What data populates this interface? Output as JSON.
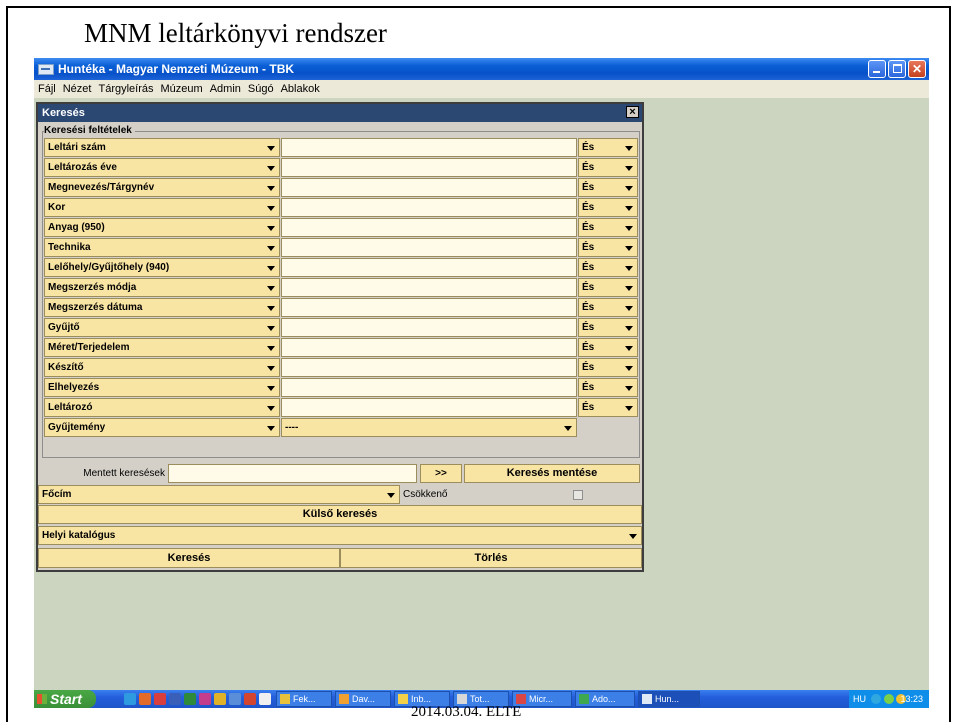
{
  "slide": {
    "title": "MNM leltárkönyvi rendszer",
    "footer": "2014.03.04. ELTE"
  },
  "window": {
    "title": "Huntéka - Magyar Nemzeti Múzeum - TBK"
  },
  "menu": [
    "Fájl",
    "Nézet",
    "Tárgyleírás",
    "Múzeum",
    "Admin",
    "Súgó",
    "Ablakok"
  ],
  "search": {
    "title": "Keresés",
    "group_label": "Keresési feltételek",
    "criteria": [
      {
        "field": "Leltári szám",
        "op": "És"
      },
      {
        "field": "Leltározás éve",
        "op": "És"
      },
      {
        "field": "Megnevezés/Tárgynév",
        "op": "És"
      },
      {
        "field": "Kor",
        "op": "És"
      },
      {
        "field": "Anyag (950)",
        "op": "És"
      },
      {
        "field": "Technika",
        "op": "És"
      },
      {
        "field": "Lelőhely/Gyűjtőhely (940)",
        "op": "És"
      },
      {
        "field": "Megszerzés módja",
        "op": "És"
      },
      {
        "field": "Megszerzés dátuma",
        "op": "És"
      },
      {
        "field": "Gyűjtő",
        "op": "És"
      },
      {
        "field": "Méret/Terjedelem",
        "op": "És"
      },
      {
        "field": "Készítő",
        "op": "És"
      },
      {
        "field": "Elhelyezés",
        "op": "És"
      },
      {
        "field": "Leltározó",
        "op": "És"
      }
    ],
    "collection": {
      "field": "Gyűjtemény",
      "value": "----"
    },
    "saved_label": "Mentett keresések",
    "go_label": ">>",
    "save_label": "Keresés mentése",
    "sort_field": "Főcím",
    "sort_desc_label": "Csökkenő",
    "external_label": "Külső keresés",
    "catalog": "Helyi katalógus",
    "search_button": "Keresés",
    "clear_button": "Törlés"
  },
  "taskbar": {
    "start": "Start",
    "tasks": [
      "Fek...",
      "Dav...",
      "Inb...",
      "Tot...",
      "Micr...",
      "Ado...",
      "Hun..."
    ],
    "lang": "HU",
    "clock": "13:23"
  },
  "colors": {
    "field": "#f8e4a3",
    "input": "#fffbe8",
    "dialog": "#d4d0c8",
    "desktop": "#cbd5bf",
    "titlebar": "#0a5fd6"
  }
}
